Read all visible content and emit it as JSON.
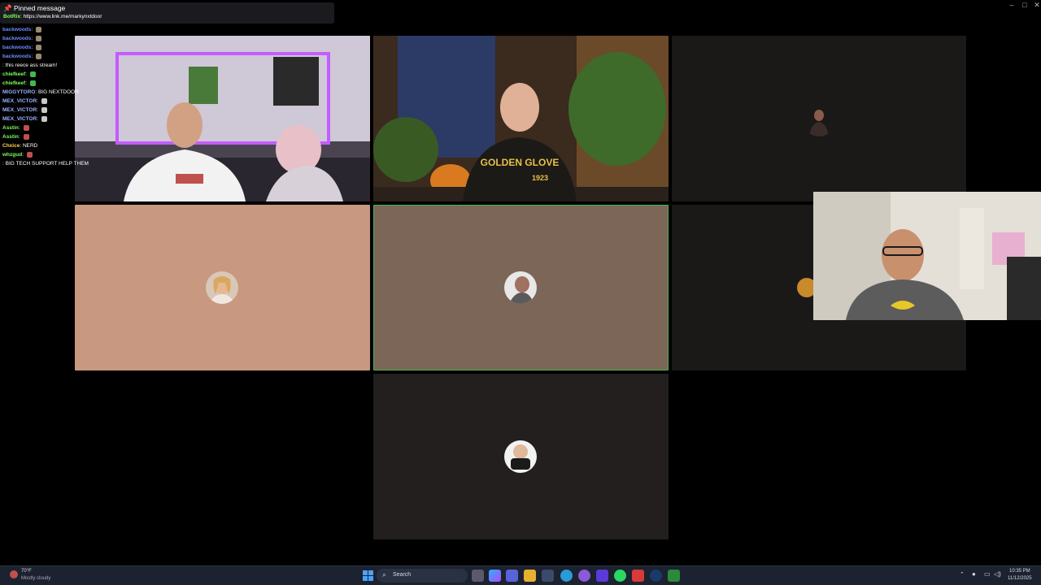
{
  "pinned": {
    "header": "Pinned message",
    "user": "BotRix",
    "text": "https://www.link.me/markynxtdoor"
  },
  "chat": [
    {
      "user": "backwoods",
      "color": "#6b8cff",
      "text": "",
      "emote": "#9a8a70"
    },
    {
      "user": "backwoods",
      "color": "#6b8cff",
      "text": "",
      "emote": "#9a8a70"
    },
    {
      "user": "backwoods",
      "color": "#6b8cff",
      "text": "",
      "emote": "#9a8a70"
    },
    {
      "user": "backwoods",
      "color": "#6b8cff",
      "text": "",
      "emote": "#9a8a70"
    },
    {
      "user": "",
      "color": "#ff5a5a",
      "text": "this reece ass stream!",
      "emote": ""
    },
    {
      "user": "chiefkeef",
      "color": "#7cff5a",
      "text": "",
      "emote": "#3fb950"
    },
    {
      "user": "chiefkeef",
      "color": "#7cff5a",
      "text": "",
      "emote": "#3fb950"
    },
    {
      "user": "MIGGYTORO",
      "color": "#9ab0ff",
      "text": "BIG NEXTDOOR",
      "emote": ""
    },
    {
      "user": "MEX_VICTOR",
      "color": "#9ab0ff",
      "text": "",
      "emote": "#c8c8c8"
    },
    {
      "user": "MEX_VICTOR",
      "color": "#9ab0ff",
      "text": "",
      "emote": "#c8c8c8"
    },
    {
      "user": "MEX_VICTOR",
      "color": "#9ab0ff",
      "text": "",
      "emote": "#c8c8c8"
    },
    {
      "user": "Asstin",
      "color": "#7cff5a",
      "text": "",
      "emote": "#c0504d"
    },
    {
      "user": "Asstin",
      "color": "#7cff5a",
      "text": "",
      "emote": "#c0504d"
    },
    {
      "user": "Chxice",
      "color": "#ffd24a",
      "text": "NERD",
      "emote": ""
    },
    {
      "user": "whzgud",
      "color": "#7cff5a",
      "text": "",
      "emote": "#c0504d"
    },
    {
      "user": "",
      "color": "#ff5a5a",
      "text": "BIG TECH SUPPORT HELP THEM",
      "emote": ""
    }
  ],
  "taskbar": {
    "weather_temp": "70°F",
    "weather_desc": "Mostly cloudy",
    "search_placeholder": "Search",
    "time": "10:35 PM",
    "date": "11/12/2025"
  },
  "colors": {
    "tile_peach": "#c99880",
    "tile_brown": "#7b6658",
    "tile_dark": "#231f1e",
    "tile_dark2": "#1b1818",
    "active_border": "#3fb950"
  }
}
